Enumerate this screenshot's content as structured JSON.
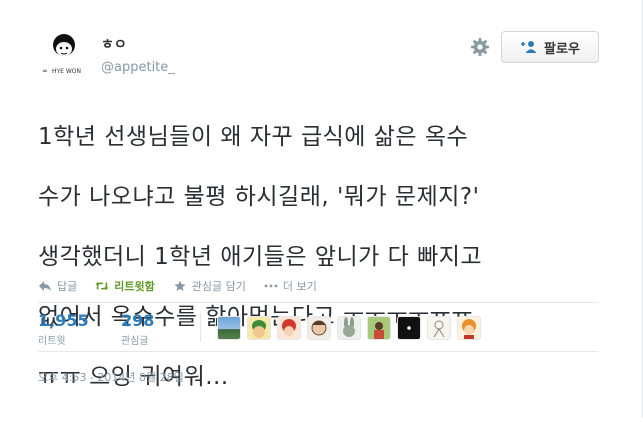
{
  "user": {
    "display_name": "ㅎㅇ",
    "handle": "@appetite_",
    "avatar_icon": "cartoon-face-icon",
    "avatar_caption": "HYE WON"
  },
  "buttons": {
    "follow_label": "팔로우",
    "settings_icon": "gear-icon",
    "follow_icon": "add-user-icon"
  },
  "tweet": {
    "lines": [
      "1학년 선생님들이 왜 자꾸 급식에 삶은 옥수",
      "수가 나오냐고 불평 하시길래, '뭐가 문제지?'",
      "생각했더니 1학년 애기들은 앞니가 다 빠지고",
      "없어서 옥수수를 핥아먹는다고 ㅜㅜㅜㅜㅠㅠ",
      "ㅠㅠ 으잉 귀여워..."
    ]
  },
  "actions": [
    {
      "label": "답글",
      "icon": "reply-icon"
    },
    {
      "label": "리트윗함",
      "icon": "retweet-icon"
    },
    {
      "label": "관심글 담기",
      "icon": "star-icon"
    },
    {
      "label": "더 보기",
      "icon": "more-icon"
    }
  ],
  "stats": {
    "retweets_count": "1,955",
    "retweets_label": "리트윗",
    "favorites_count": "298",
    "favorites_label": "관심글"
  },
  "favoriters": [
    {
      "icon": "user-avatar-landscape-icon"
    },
    {
      "icon": "user-avatar-green-character-icon"
    },
    {
      "icon": "user-avatar-red-character-icon"
    },
    {
      "icon": "user-avatar-sketch-face-icon"
    },
    {
      "icon": "user-avatar-rabbit-icon"
    },
    {
      "icon": "user-avatar-green-photo-icon"
    },
    {
      "icon": "user-avatar-black-dot-icon"
    },
    {
      "icon": "user-avatar-doodle-icon"
    },
    {
      "icon": "user-avatar-orange-character-icon"
    }
  ],
  "timestamp": "오후 4:53 - 2014년 8월 28일",
  "colors": {
    "link_blue": "#2b7bb9",
    "retweet_green": "#609928",
    "muted_gray": "#8899a6",
    "text": "#292f33"
  }
}
